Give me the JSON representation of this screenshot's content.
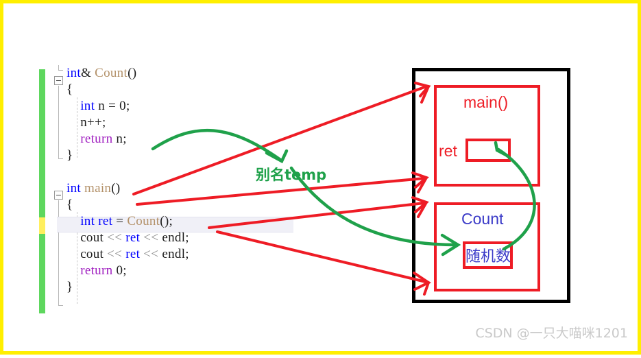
{
  "frame": {
    "border_color": "#ffef00",
    "background": "#ffffff"
  },
  "editor": {
    "gutter": {
      "saved_color": "#5ed75e",
      "modified_color": "#ffef5e"
    },
    "highlighted_line_index": 8,
    "lines": [
      {
        "tokens": [
          {
            "t": "int",
            "c": "kw"
          },
          {
            "t": "& ",
            "c": "pl"
          },
          {
            "t": "Count",
            "c": "fn"
          },
          {
            "t": "()",
            "c": "pl"
          }
        ]
      },
      {
        "tokens": [
          {
            "t": "{",
            "c": "pl"
          }
        ]
      },
      {
        "tokens": [
          {
            "t": "    ",
            "c": "pl"
          },
          {
            "t": "int",
            "c": "kw"
          },
          {
            "t": " n = ",
            "c": "pl"
          },
          {
            "t": "0",
            "c": "num"
          },
          {
            "t": ";",
            "c": "pl"
          }
        ]
      },
      {
        "tokens": [
          {
            "t": "    n++;",
            "c": "pl"
          }
        ]
      },
      {
        "tokens": [
          {
            "t": "    ",
            "c": "pl"
          },
          {
            "t": "return",
            "c": "kw2"
          },
          {
            "t": " n;",
            "c": "pl"
          }
        ]
      },
      {
        "tokens": [
          {
            "t": "}",
            "c": "pl"
          }
        ]
      },
      {
        "tokens": []
      },
      {
        "tokens": [
          {
            "t": "int",
            "c": "kw"
          },
          {
            "t": " ",
            "c": "pl"
          },
          {
            "t": "main",
            "c": "fn"
          },
          {
            "t": "()",
            "c": "pl"
          }
        ]
      },
      {
        "tokens": [
          {
            "t": "{",
            "c": "pl"
          }
        ]
      },
      {
        "tokens": [
          {
            "t": "    ",
            "c": "pl"
          },
          {
            "t": "int",
            "c": "kw"
          },
          {
            "t": " ",
            "c": "pl"
          },
          {
            "t": "ret",
            "c": "kw"
          },
          {
            "t": " = ",
            "c": "pl"
          },
          {
            "t": "Count",
            "c": "fn"
          },
          {
            "t": "();",
            "c": "pl"
          }
        ]
      },
      {
        "tokens": [
          {
            "t": "    cout ",
            "c": "pl"
          },
          {
            "t": "<<",
            "c": "op"
          },
          {
            "t": " ",
            "c": "pl"
          },
          {
            "t": "ret",
            "c": "kw"
          },
          {
            "t": " ",
            "c": "pl"
          },
          {
            "t": "<<",
            "c": "op"
          },
          {
            "t": " endl;",
            "c": "pl"
          }
        ]
      },
      {
        "tokens": [
          {
            "t": "    cout ",
            "c": "pl"
          },
          {
            "t": "<<",
            "c": "op"
          },
          {
            "t": " ",
            "c": "pl"
          },
          {
            "t": "ret",
            "c": "kw"
          },
          {
            "t": " ",
            "c": "pl"
          },
          {
            "t": "<<",
            "c": "op"
          },
          {
            "t": " endl;",
            "c": "pl"
          }
        ]
      },
      {
        "tokens": [
          {
            "t": "    ",
            "c": "pl"
          },
          {
            "t": "return",
            "c": "kw2"
          },
          {
            "t": " ",
            "c": "pl"
          },
          {
            "t": "0",
            "c": "num"
          },
          {
            "t": ";",
            "c": "pl"
          }
        ]
      },
      {
        "tokens": [
          {
            "t": "}",
            "c": "pl"
          }
        ]
      }
    ],
    "plain_text": [
      "int& Count()",
      "{",
      "    int n = 0;",
      "    n++;",
      "    return n;",
      "}",
      "",
      "int main()",
      "{",
      "    int ret = Count();",
      "    cout << ret << endl;",
      "    cout << ret << endl;",
      "    return 0;",
      "}"
    ]
  },
  "memory": {
    "outer_border_color": "#000000",
    "main_frame": {
      "title": "main()",
      "title_color": "#ee1c25",
      "variable_label": "ret",
      "variable_box_value": ""
    },
    "count_frame": {
      "title": "Count",
      "title_color": "#3b3bc8",
      "inner_label": "随机数"
    }
  },
  "annotations": {
    "alias_label": "别名temp",
    "alias_color": "#1fa14a",
    "arrow_color_red": "#ee1c25",
    "arrow_color_green": "#1fa14a"
  },
  "watermark": {
    "text": "CSDN @一只大喵咪1201",
    "color": "#c9c9c9"
  }
}
